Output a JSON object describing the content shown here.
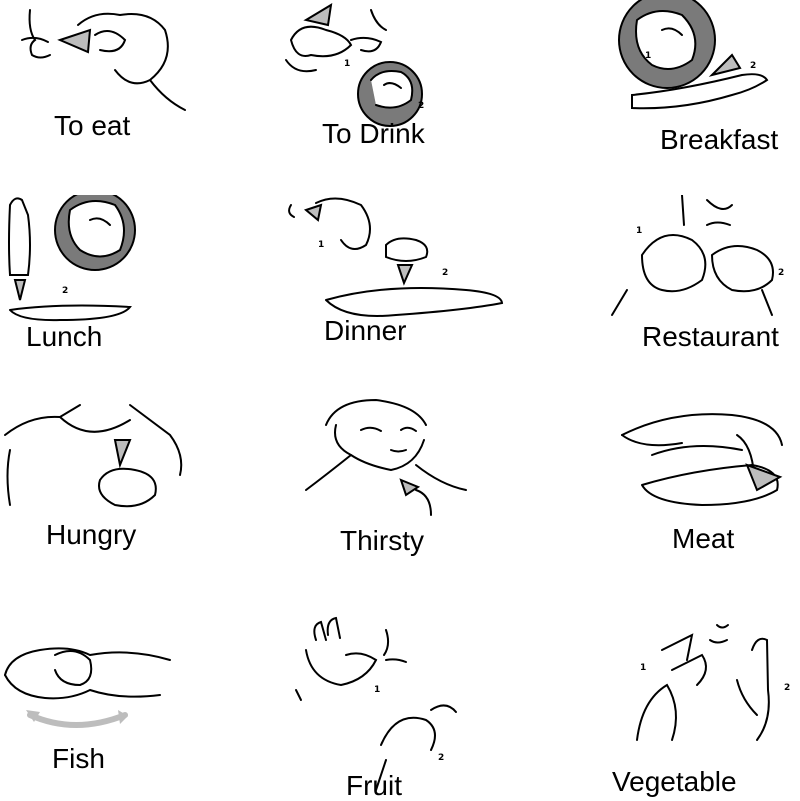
{
  "signs": [
    {
      "label": "To eat",
      "icon": "to-eat-sign-icon"
    },
    {
      "label": "To Drink",
      "icon": "to-drink-sign-icon"
    },
    {
      "label": "Breakfast",
      "icon": "breakfast-sign-icon"
    },
    {
      "label": "Lunch",
      "icon": "lunch-sign-icon"
    },
    {
      "label": "Dinner",
      "icon": "dinner-sign-icon"
    },
    {
      "label": "Restaurant",
      "icon": "restaurant-sign-icon"
    },
    {
      "label": "Hungry",
      "icon": "hungry-sign-icon"
    },
    {
      "label": "Thirsty",
      "icon": "thirsty-sign-icon"
    },
    {
      "label": "Meat",
      "icon": "meat-sign-icon"
    },
    {
      "label": "Fish",
      "icon": "fish-sign-icon"
    },
    {
      "label": "Fruit",
      "icon": "fruit-sign-icon"
    },
    {
      "label": "Vegetable",
      "icon": "vegetable-sign-icon"
    }
  ],
  "step_markers": [
    "1",
    "2"
  ],
  "colors": {
    "ink": "#000000",
    "shade": "#7a7a7a",
    "arrow": "#bdbdbd"
  }
}
